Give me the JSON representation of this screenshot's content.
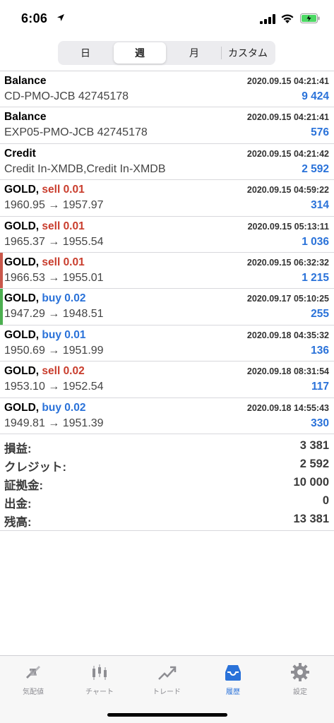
{
  "status_bar": {
    "time": "6:06"
  },
  "segments": [
    {
      "label": "日"
    },
    {
      "label": "週",
      "active": true
    },
    {
      "label": "月"
    },
    {
      "label": "カスタム"
    }
  ],
  "rows": [
    {
      "title": "Balance",
      "date": "2020.09.15 04:21:41",
      "subtitle": "CD-PMO-JCB 42745178",
      "amount": "9 424"
    },
    {
      "title": "Balance",
      "date": "2020.09.15 04:21:41",
      "subtitle": "EXP05-PMO-JCB 42745178",
      "amount": "576"
    },
    {
      "title": "Credit",
      "date": "2020.09.15 04:21:42",
      "subtitle": "Credit In-XMDB,Credit In-XMDB",
      "amount": "2 592"
    },
    {
      "title": "GOLD,",
      "side": "sell 0.01",
      "side_type": "sell",
      "date": "2020.09.15 04:59:22",
      "subtitle": "1960.95 → 1957.97",
      "amount": "314"
    },
    {
      "title": "GOLD,",
      "side": "sell 0.01",
      "side_type": "sell",
      "date": "2020.09.15 05:13:11",
      "subtitle": "1965.37 → 1955.54",
      "amount": "1 036"
    },
    {
      "title": "GOLD,",
      "side": "sell 0.01",
      "side_type": "sell",
      "date": "2020.09.15 06:32:32",
      "subtitle": "1966.53 → 1955.01",
      "amount": "1 215",
      "bar_color": "#c9574a"
    },
    {
      "title": "GOLD,",
      "side": "buy 0.02",
      "side_type": "buy",
      "date": "2020.09.17 05:10:25",
      "subtitle": "1947.29 → 1948.51",
      "amount": "255",
      "bar_color": "#4caf50"
    },
    {
      "title": "GOLD,",
      "side": "buy 0.01",
      "side_type": "buy",
      "date": "2020.09.18 04:35:32",
      "subtitle": "1950.69 → 1951.99",
      "amount": "136"
    },
    {
      "title": "GOLD,",
      "side": "sell 0.02",
      "side_type": "sell",
      "date": "2020.09.18 08:31:54",
      "subtitle": "1953.10 → 1952.54",
      "amount": "117"
    },
    {
      "title": "GOLD,",
      "side": "buy 0.02",
      "side_type": "buy",
      "date": "2020.09.18 14:55:43",
      "subtitle": "1949.81 → 1951.39",
      "amount": "330"
    }
  ],
  "summary": [
    {
      "label": "損益:",
      "value": "3 381"
    },
    {
      "label": "クレジット:",
      "value": "2 592"
    },
    {
      "label": "証拠金:",
      "value": "10 000"
    },
    {
      "label": "出金:",
      "value": "0"
    },
    {
      "label": "残高:",
      "value": "13 381"
    }
  ],
  "tabs": [
    {
      "label": "気配値",
      "icon": "quotes-icon"
    },
    {
      "label": "チャート",
      "icon": "chart-icon"
    },
    {
      "label": "トレード",
      "icon": "trade-icon"
    },
    {
      "label": "履歴",
      "icon": "history-icon",
      "active": true
    },
    {
      "label": "設定",
      "icon": "settings-icon"
    }
  ],
  "colors": {
    "accent": "#2a72d9",
    "sell": "#c93d2d",
    "buy": "#2a72d9"
  }
}
